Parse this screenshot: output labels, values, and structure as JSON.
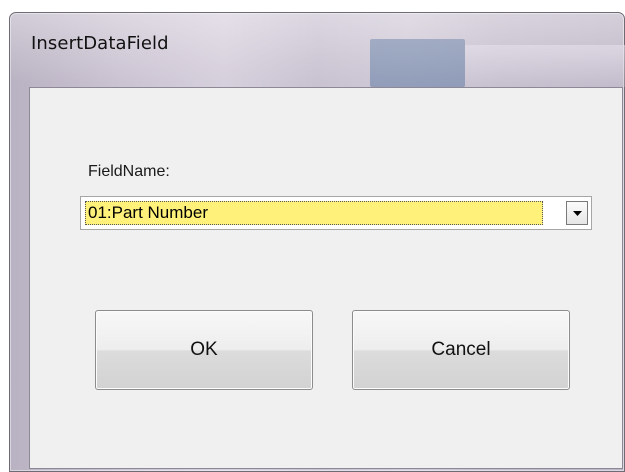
{
  "window": {
    "title": "InsertDataField"
  },
  "form": {
    "field_label": "FieldName:",
    "field_value": "01:Part Number"
  },
  "buttons": {
    "ok_label": "OK",
    "cancel_label": "Cancel"
  },
  "icons": {
    "dropdown": "chevron-down-icon"
  },
  "colors": {
    "selection_highlight": "#fff17a",
    "client_background": "#f0f0f0"
  }
}
